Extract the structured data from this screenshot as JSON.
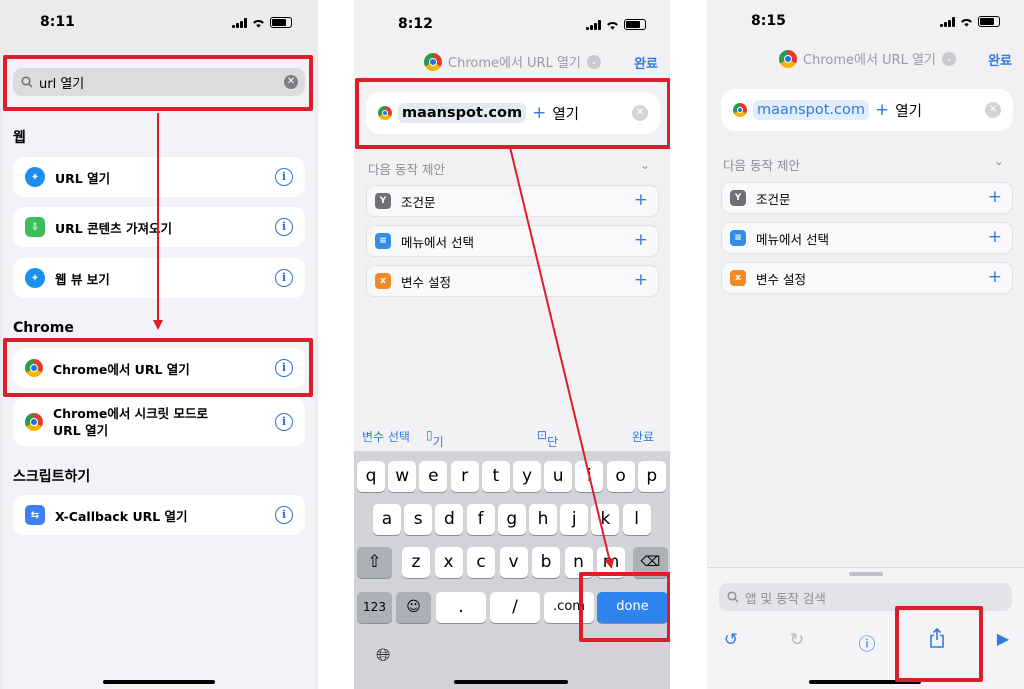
{
  "phone1": {
    "time": "8:11",
    "search": {
      "value": "url 열기"
    },
    "sections": {
      "web": "웹",
      "chrome": "Chrome",
      "script": "스크립트하기"
    },
    "web_items": [
      {
        "label": "URL 열기",
        "icon": "safari-icon"
      },
      {
        "label": "URL 콘텐츠 가져오기",
        "icon": "download-icon"
      },
      {
        "label": "웹 뷰 보기",
        "icon": "safari-icon"
      }
    ],
    "chrome_items": [
      {
        "label": "Chrome에서 URL 열기"
      },
      {
        "label_line1": "Chrome에서 시크릿 모드로",
        "label_line2": "URL 열기"
      }
    ],
    "script_items": [
      {
        "label": "X-Callback URL 열기",
        "icon": "callback-icon"
      }
    ]
  },
  "phone2": {
    "time": "8:12",
    "header_title": "Chrome에서 URL 열기",
    "done": "완료",
    "url_token": "maanspot.com",
    "action_word": "열기",
    "suggest_title": "다음 동작 제안",
    "suggestions": [
      "조건문",
      "메뉴에서 선택",
      "변수 설정"
    ],
    "quickbar": {
      "variable": "변수 선택",
      "device": "기기 세부사항",
      "shortcut_input": "단축어 입력",
      "done": "완료"
    },
    "keys": {
      "row1": [
        "q",
        "w",
        "e",
        "r",
        "t",
        "y",
        "u",
        "i",
        "o",
        "p"
      ],
      "row2": [
        "a",
        "s",
        "d",
        "f",
        "g",
        "h",
        "j",
        "k",
        "l"
      ],
      "row3": [
        "z",
        "x",
        "c",
        "v",
        "b",
        "n",
        "m"
      ],
      "num": "123",
      "dot": ".",
      "slash": "/",
      "com": ".com",
      "done": "done"
    }
  },
  "phone3": {
    "time": "8:15",
    "header_title": "Chrome에서 URL 열기",
    "done": "완료",
    "url_token": "maanspot.com",
    "action_word": "열기",
    "suggest_title": "다음 동작 제안",
    "suggestions": [
      "조건문",
      "메뉴에서 선택",
      "변수 설정"
    ],
    "search_placeholder": "앱 및 동작 검색"
  },
  "colors": {
    "highlight": "#dc1e2b",
    "accent": "#2f7bdf"
  }
}
